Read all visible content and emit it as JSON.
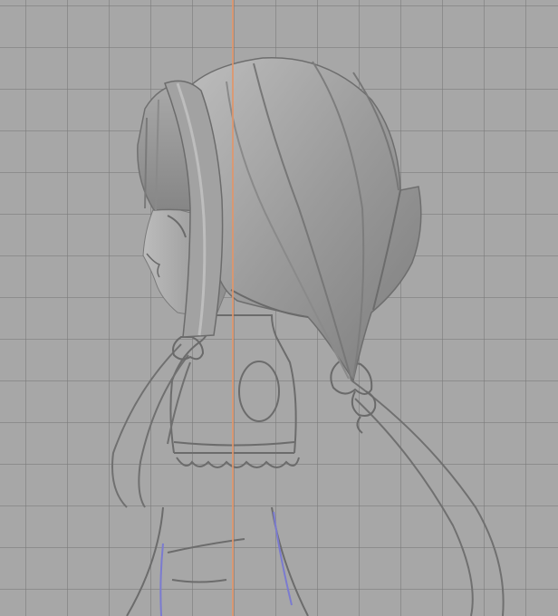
{
  "viewport": {
    "view": "side",
    "grid": true,
    "colors": {
      "background": "#a7a7a7",
      "grid_line": "#8f8f8f",
      "axis_line": "#e0956a",
      "mesh_shading": "#8c8c8c",
      "wire_outline": "#6e6e6e",
      "guide_curve": "#7a7ac8"
    }
  }
}
